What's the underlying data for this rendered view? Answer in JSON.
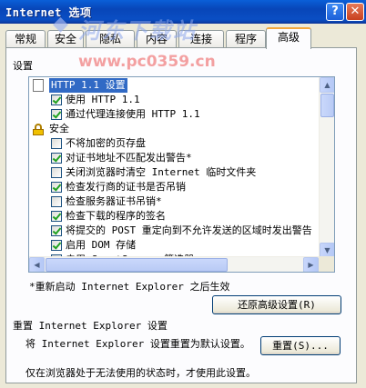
{
  "window": {
    "title": "Internet 选项",
    "help_glyph": "?",
    "close_glyph": "✕"
  },
  "watermark": {
    "logo_text": "河东下载站",
    "url": "www.pc0359.cn"
  },
  "tabs": [
    {
      "label": "常规"
    },
    {
      "label": "安全"
    },
    {
      "label": "隐私"
    },
    {
      "label": "内容"
    },
    {
      "label": "连接"
    },
    {
      "label": "程序"
    },
    {
      "label": "高级",
      "active": true
    }
  ],
  "settings": {
    "group_label": "设置",
    "items": [
      {
        "label": "HTTP 1.1 设置",
        "kind": "header",
        "icon": "document-icon"
      },
      {
        "label": "使用 HTTP 1.1",
        "kind": "checkbox",
        "checked": true
      },
      {
        "label": "通过代理连接使用 HTTP 1.1",
        "kind": "checkbox",
        "checked": true
      },
      {
        "label": "安全",
        "kind": "group",
        "icon": "lock-icon"
      },
      {
        "label": "不将加密的页存盘",
        "kind": "checkbox",
        "checked": false
      },
      {
        "label": "对证书地址不匹配发出警告*",
        "kind": "checkbox",
        "checked": true
      },
      {
        "label": "关闭浏览器时清空 Internet 临时文件夹",
        "kind": "checkbox",
        "checked": false
      },
      {
        "label": "检查发行商的证书是否吊销",
        "kind": "checkbox",
        "checked": true
      },
      {
        "label": "检查服务器证书吊销*",
        "kind": "checkbox",
        "checked": false
      },
      {
        "label": "检查下载的程序的签名",
        "kind": "checkbox",
        "checked": true
      },
      {
        "label": "将提交的 POST 重定向到不允许发送的区域时发出警告",
        "kind": "checkbox",
        "checked": true
      },
      {
        "label": "启用 DOM 存储",
        "kind": "checkbox",
        "checked": true
      },
      {
        "label": "启用 SmartScreen 筛选器",
        "kind": "checkbox",
        "checked": true
      }
    ],
    "scroll_up_glyph": "▲",
    "scroll_down_glyph": "▼",
    "scroll_left_glyph": "◀",
    "scroll_right_glyph": "▶"
  },
  "restart_note": "*重新启动 Internet Explorer 之后生效",
  "restore_button": "还原高级设置(R)",
  "reset_section": {
    "title": "重置 Internet Explorer 设置",
    "description": "将 Internet Explorer 设置重置为默认设置。",
    "button": "重置(S)...",
    "warning": "仅在浏览器处于无法使用的状态时，才使用此设置。"
  }
}
